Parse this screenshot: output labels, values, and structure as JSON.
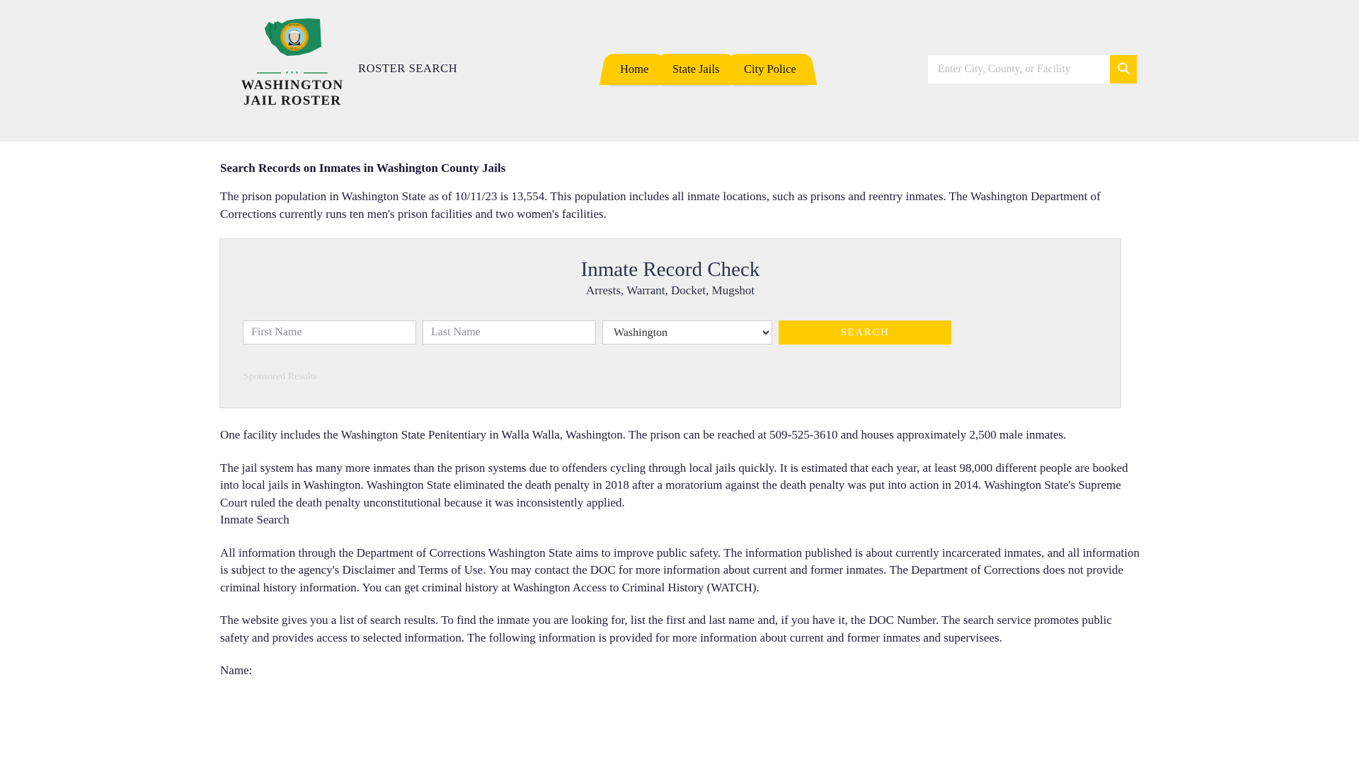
{
  "header": {
    "logo": {
      "line1": "WASHINGTON",
      "line2": "JAIL ROSTER",
      "flag_icon": "washington-state-flag-icon"
    },
    "tagline": "ROSTER SEARCH",
    "nav": [
      {
        "label": "Home"
      },
      {
        "label": "State Jails"
      },
      {
        "label": "City Police"
      }
    ],
    "search": {
      "placeholder": "Enter City, County, or Facility",
      "value": "",
      "button_icon": "search-icon"
    }
  },
  "main": {
    "section_title": "Search Records on Inmates in Washington County Jails",
    "intro_paragraph": "The prison population in Washington State as of 10/11/23 is 13,554. This population includes all inmate locations, such as prisons and reentry inmates. The Washington Department of Corrections currently runs ten men's prison facilities and two women's facilities.",
    "panel": {
      "title": "Inmate Record Check",
      "subtitle": "Arrests, Warrant, Docket, Mugshot",
      "first_name_placeholder": "First Name",
      "first_name_value": "",
      "last_name_placeholder": "Last Name",
      "last_name_value": "",
      "state_selected": "Washington",
      "state_options": [
        "Washington"
      ],
      "search_button": "SEARCH",
      "sponsored_label": "Sponsored Results"
    },
    "paragraphs": [
      "One facility includes the Washington State Penitentiary in Walla Walla, Washington. The prison can be reached at 509-525-3610 and houses approximately 2,500 male inmates.",
      "The jail system has many more inmates than the prison systems due to offenders cycling through local jails quickly. It is estimated that each year, at least 98,000 different people are booked into local jails in Washington. Washington State eliminated the death penalty in 2018 after a moratorium against the death penalty was put into action in 2014. Washington State's Supreme Court ruled the death penalty unconstitutional because it was inconsistently applied.",
      "All information through the Department of Corrections Washington State aims to improve public safety. The information published is about currently incarcerated inmates, and all information is subject to the agency's Disclaimer and Terms of Use. You may contact the DOC for more information about current and former inmates. The Department of Corrections does not provide criminal history information. You can get criminal history at Washington Access to Criminal History (WATCH).",
      "The website gives you a list of search results. To find the inmate you are looking for, list the first and last name and, if you have it, the DOC Number. The search service promotes public safety and provides access to selected information. The following information is provided for more information about current and former inmates and supervisees."
    ],
    "inmate_search_line": "Inmate Search",
    "trailing_label": "Name:"
  },
  "colors": {
    "accent_yellow": "#ffcc00",
    "header_bg": "#efefef",
    "flag_green": "#1d8a5e",
    "text_dark": "#21213d"
  }
}
